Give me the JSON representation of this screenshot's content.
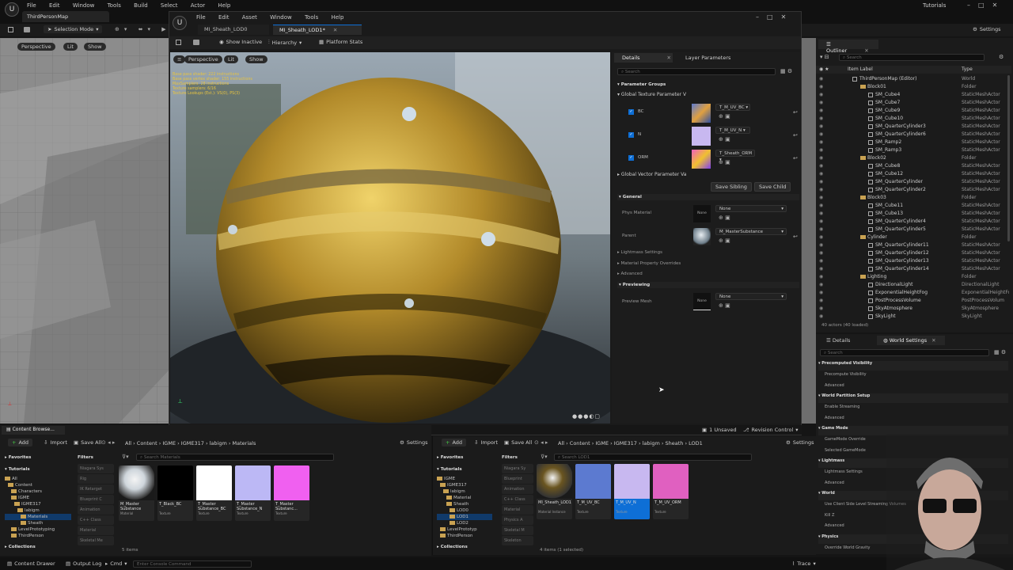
{
  "main": {
    "menu": [
      "File",
      "Edit",
      "Window",
      "Tools",
      "Build",
      "Select",
      "Actor",
      "Help"
    ],
    "map_tab": "ThirdPersonMap",
    "tutorials": "Tutorials",
    "selection_mode": "Selection Mode",
    "settings": "Settings",
    "vp": {
      "perspective": "Perspective",
      "lit": "Lit",
      "show": "Show"
    }
  },
  "mat": {
    "tabs": [
      "MI_Sheath_LOD0",
      "MI_Sheath_LOD1*"
    ],
    "menu": [
      "File",
      "Edit",
      "Asset",
      "Window",
      "Tools",
      "Help"
    ],
    "toolbar": {
      "show_inactive": "Show Inactive",
      "hierarchy": "Hierarchy",
      "platform_stats": "Platform Stats"
    },
    "vp": {
      "perspective": "Perspective",
      "lit": "Lit",
      "show": "Show"
    },
    "stats": [
      "Base pass shader: 222 instructions",
      "Base pass vertex shader: 155 instructions",
      "MaxSamplers: 28 instructions",
      "Texture samplers: 6/16",
      "Texture Lookups (Est.): VS(0), PS(3)"
    ],
    "details": {
      "tab_details": "Details",
      "tab_layers": "Layer Parameters",
      "search": "Search",
      "param_groups": "Parameter Groups",
      "global_tex": "Global Texture Parameter V",
      "texparams": [
        {
          "name": "BC",
          "tex": "T_M_UV_BC"
        },
        {
          "name": "N",
          "tex": "T_M_UV_N"
        },
        {
          "name": "ORM",
          "tex": "T_Sheath_ORM"
        }
      ],
      "global_vec": "Global Vector Parameter Va",
      "save_sibling": "Save Sibling",
      "save_child": "Save Child",
      "general": "General",
      "phys_material": "Phys Material",
      "none": "None",
      "parent": "Parent",
      "parent_val": "M_MasterSubstance",
      "lightmass": "Lightmass Settings",
      "mat_overrides": "Material Property Overrides",
      "advanced": "Advanced",
      "previewing": "Previewing",
      "preview_mesh": "Preview Mesh"
    }
  },
  "outliner": {
    "title": "Outliner",
    "search": "Search",
    "col_label": "Item Label",
    "col_type": "Type",
    "items": [
      {
        "label": "ThirdPersonMap (Editor)",
        "type": "World",
        "indent": 0,
        "kind": "world"
      },
      {
        "label": "Block01",
        "type": "Folder",
        "indent": 1,
        "kind": "folder"
      },
      {
        "label": "SM_Cube4",
        "type": "StaticMeshActor",
        "indent": 2,
        "kind": "mesh"
      },
      {
        "label": "SM_Cube7",
        "type": "StaticMeshActor",
        "indent": 2,
        "kind": "mesh"
      },
      {
        "label": "SM_Cube9",
        "type": "StaticMeshActor",
        "indent": 2,
        "kind": "mesh"
      },
      {
        "label": "SM_Cube10",
        "type": "StaticMeshActor",
        "indent": 2,
        "kind": "mesh"
      },
      {
        "label": "SM_QuarterCylinder3",
        "type": "StaticMeshActor",
        "indent": 2,
        "kind": "mesh"
      },
      {
        "label": "SM_QuarterCylinder6",
        "type": "StaticMeshActor",
        "indent": 2,
        "kind": "mesh"
      },
      {
        "label": "SM_Ramp2",
        "type": "StaticMeshActor",
        "indent": 2,
        "kind": "mesh"
      },
      {
        "label": "SM_Ramp3",
        "type": "StaticMeshActor",
        "indent": 2,
        "kind": "mesh"
      },
      {
        "label": "Block02",
        "type": "Folder",
        "indent": 1,
        "kind": "folder"
      },
      {
        "label": "SM_Cube8",
        "type": "StaticMeshActor",
        "indent": 2,
        "kind": "mesh"
      },
      {
        "label": "SM_Cube12",
        "type": "StaticMeshActor",
        "indent": 2,
        "kind": "mesh"
      },
      {
        "label": "SM_QuarterCylinder",
        "type": "StaticMeshActor",
        "indent": 2,
        "kind": "mesh"
      },
      {
        "label": "SM_QuarterCylinder2",
        "type": "StaticMeshActor",
        "indent": 2,
        "kind": "mesh"
      },
      {
        "label": "Block03",
        "type": "Folder",
        "indent": 1,
        "kind": "folder"
      },
      {
        "label": "SM_Cube11",
        "type": "StaticMeshActor",
        "indent": 2,
        "kind": "mesh"
      },
      {
        "label": "SM_Cube13",
        "type": "StaticMeshActor",
        "indent": 2,
        "kind": "mesh"
      },
      {
        "label": "SM_QuarterCylinder4",
        "type": "StaticMeshActor",
        "indent": 2,
        "kind": "mesh"
      },
      {
        "label": "SM_QuarterCylinder5",
        "type": "StaticMeshActor",
        "indent": 2,
        "kind": "mesh"
      },
      {
        "label": "Cylinder",
        "type": "Folder",
        "indent": 1,
        "kind": "folder"
      },
      {
        "label": "SM_QuarterCylinder11",
        "type": "StaticMeshActor",
        "indent": 2,
        "kind": "mesh"
      },
      {
        "label": "SM_QuarterCylinder12",
        "type": "StaticMeshActor",
        "indent": 2,
        "kind": "mesh"
      },
      {
        "label": "SM_QuarterCylinder13",
        "type": "StaticMeshActor",
        "indent": 2,
        "kind": "mesh"
      },
      {
        "label": "SM_QuarterCylinder14",
        "type": "StaticMeshActor",
        "indent": 2,
        "kind": "mesh"
      },
      {
        "label": "Lighting",
        "type": "Folder",
        "indent": 1,
        "kind": "folder"
      },
      {
        "label": "DirectionalLight",
        "type": "DirectionalLight",
        "indent": 2,
        "kind": "mesh"
      },
      {
        "label": "ExponentialHeightFog",
        "type": "ExponentialHeightFog",
        "indent": 2,
        "kind": "mesh"
      },
      {
        "label": "PostProcessVolume",
        "type": "PostProcessVolum",
        "indent": 2,
        "kind": "mesh"
      },
      {
        "label": "SkyAtmosphere",
        "type": "SkyAtmosphere",
        "indent": 2,
        "kind": "mesh"
      },
      {
        "label": "SkyLight",
        "type": "SkyLight",
        "indent": 2,
        "kind": "mesh"
      }
    ],
    "count": "40 actors (40 loaded)"
  },
  "world": {
    "tab_details": "Details",
    "tab_ws": "World Settings",
    "search": "Search",
    "rows": [
      {
        "t": "Precomputed Visibility",
        "s": 1
      },
      {
        "t": "Precompute Visibility",
        "s": 0
      },
      {
        "t": "Advanced",
        "s": 0
      },
      {
        "t": "World Partition Setup",
        "s": 1
      },
      {
        "t": "Enable Streaming",
        "s": 0
      },
      {
        "t": "Advanced",
        "s": 0
      },
      {
        "t": "Game Mode",
        "s": 1
      },
      {
        "t": "GameMode Override",
        "s": 0
      },
      {
        "t": "Selected GameMode",
        "s": 0
      },
      {
        "t": "Lightmass",
        "s": 1
      },
      {
        "t": "Lightmass Settings",
        "s": 0
      },
      {
        "t": "Advanced",
        "s": 0
      },
      {
        "t": "World",
        "s": 1
      },
      {
        "t": "Use Client Side Level Streaming Volumes",
        "s": 0
      },
      {
        "t": "Kill Z",
        "s": 0
      },
      {
        "t": "Advanced",
        "s": 0
      },
      {
        "t": "Physics",
        "s": 1
      },
      {
        "t": "Override World Gravity",
        "s": 0
      }
    ]
  },
  "status": {
    "unsaved": "1 Unsaved",
    "revision": "Revision Control",
    "content_browser": "Content Browse...",
    "output_log": "Output Log",
    "cmd": "Cmd",
    "console_ph": "Enter Console Command",
    "content_drawer": "Content Drawer",
    "trace": "Trace"
  },
  "cb1": {
    "add": "Add",
    "import": "Import",
    "save_all": "Save All",
    "settings": "Settings",
    "path": [
      "All",
      "Content",
      "IGME",
      "IGME317",
      "labigm",
      "Materials"
    ],
    "favorites": "Favorites",
    "tutorials": "Tutorials",
    "filters": "Filters",
    "search_ph": "Search Materials",
    "tree": [
      {
        "l": "All",
        "i": 0
      },
      {
        "l": "Content",
        "i": 1
      },
      {
        "l": "Characters",
        "i": 2
      },
      {
        "l": "IGME",
        "i": 2
      },
      {
        "l": "IGME317",
        "i": 3
      },
      {
        "l": "labigm",
        "i": 4
      },
      {
        "l": "Materials",
        "i": 5
      },
      {
        "l": "Sheath",
        "i": 5
      },
      {
        "l": "LevelPrototyping",
        "i": 2
      },
      {
        "l": "ThirdPerson",
        "i": 2
      }
    ],
    "filters_list": [
      "Niagara Sys",
      "Rig",
      "IK Retarget",
      "Blueprint C",
      "Animation",
      "C++ Class",
      "Material",
      "Skeletal Me"
    ],
    "assets": [
      {
        "name": "M_Master Substance",
        "type": "Material",
        "color": "#cfd6dc"
      },
      {
        "name": "T_Black_BC",
        "type": "Texture",
        "color": "#000000"
      },
      {
        "name": "T_Master Substance_BC",
        "type": "Texture",
        "color": "#ffffff"
      },
      {
        "name": "T_Master Substance_N",
        "type": "Texture",
        "color": "#bcb8f5"
      },
      {
        "name": "T_Master Substanc...",
        "type": "Texture",
        "color": "#f060f0"
      }
    ],
    "count": "5 items",
    "collections": "Collections"
  },
  "cb2": {
    "add": "Add",
    "import": "Import",
    "save_all": "Save All",
    "settings": "Settings",
    "path": [
      "All",
      "Content",
      "IGME",
      "IGME317",
      "labigm",
      "Sheath",
      "LOD1"
    ],
    "favorites": "Favorites",
    "tutorials": "Tutorials",
    "filters": "Filters",
    "search_ph": "Search LOD1",
    "tree": [
      {
        "l": "IGME",
        "i": 0
      },
      {
        "l": "IGME317",
        "i": 1
      },
      {
        "l": "labigm",
        "i": 2
      },
      {
        "l": "Material",
        "i": 3
      },
      {
        "l": "Sheath",
        "i": 3
      },
      {
        "l": "LOD0",
        "i": 4
      },
      {
        "l": "LOD1",
        "i": 4
      },
      {
        "l": "LOD2",
        "i": 4
      },
      {
        "l": "LevelPrototyp",
        "i": 1
      },
      {
        "l": "ThirdPerson",
        "i": 1
      }
    ],
    "filters_list": [
      "Niagara Sy",
      "Blueprint",
      "Animation",
      "C++ Class",
      "Material",
      "Physics A",
      "Skeletal M",
      "Skeleton"
    ],
    "assets": [
      {
        "name": "MI_Sheath_LOD1",
        "type": "Material Instance",
        "color": "#6a5520"
      },
      {
        "name": "T_M_UV_BC",
        "type": "Texture",
        "color": "#5c7ad0"
      },
      {
        "name": "T_M_UV_N",
        "type": "Texture",
        "color": "#c8b8f0"
      },
      {
        "name": "T_M_UV_ORM",
        "type": "Texture",
        "color": "#e060c0"
      }
    ],
    "count": "4 items (1 selected)",
    "collections": "Collections"
  },
  "colors": {
    "accent": "#0e6fd6",
    "selected": "#103a6a",
    "gold": "#b8954a"
  }
}
